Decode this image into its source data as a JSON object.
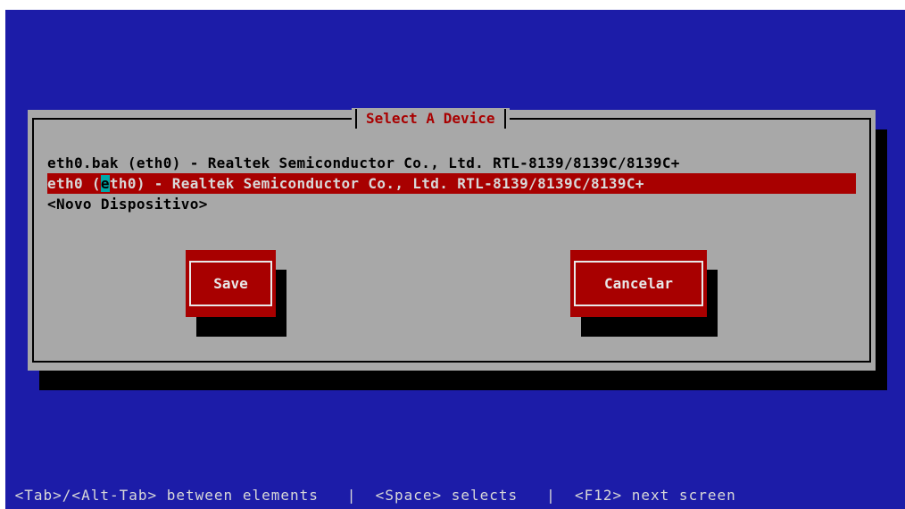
{
  "dialog": {
    "title": "Select A Device",
    "devices": [
      {
        "label": "eth0.bak (eth0) - Realtek Semiconductor Co., Ltd. RTL-8139/8139C/8139C+"
      },
      {
        "label_pre": "eth0 (",
        "label_cursor": "e",
        "label_post": "th0) - Realtek Semiconductor Co., Ltd. RTL-8139/8139C/8139C+"
      },
      {
        "label": "<Novo Dispositivo>"
      }
    ],
    "buttons": {
      "save": "Save",
      "cancel": "Cancelar"
    }
  },
  "statusbar": {
    "help": " <Tab>/<Alt-Tab> between elements   |  <Space> selects   |  <F12> next screen"
  },
  "colors": {
    "background": "#1c1ca8",
    "dialog": "#a8a8a8",
    "highlight": "#a80000",
    "cursor": "#00a8a8"
  }
}
